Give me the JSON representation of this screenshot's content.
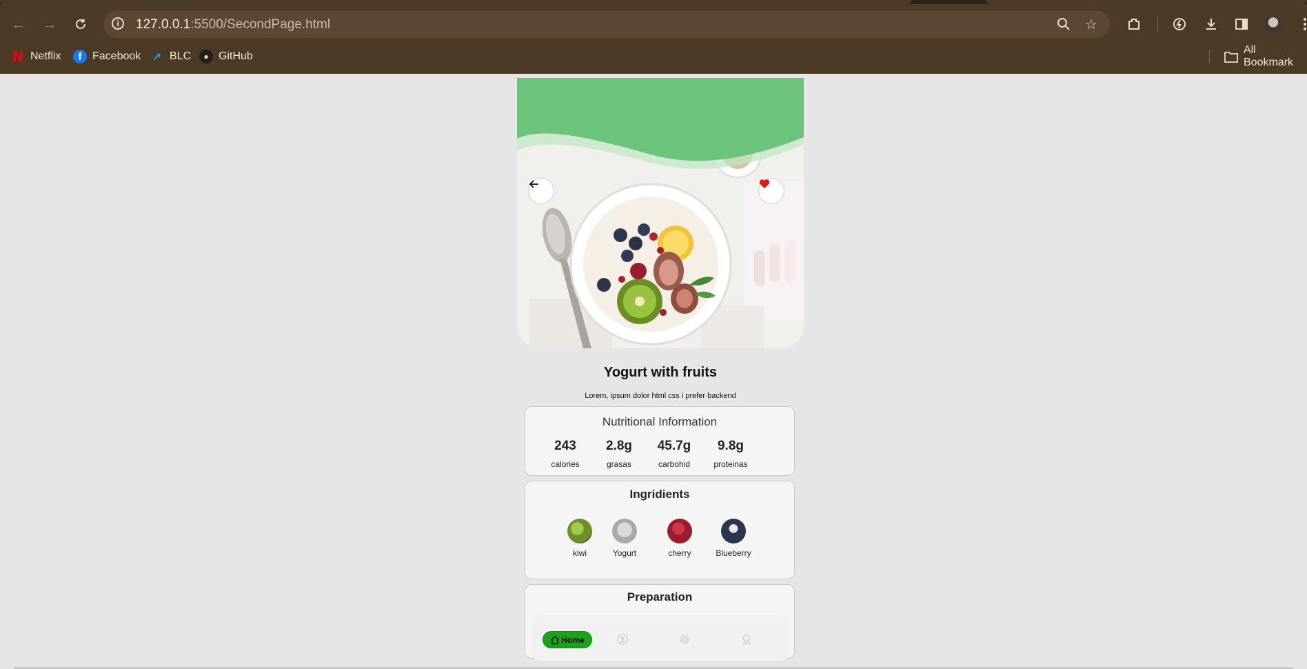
{
  "browser": {
    "url_host": "127.0.0.1",
    "url_path": ":5500/SecondPage.html",
    "bookmarks": [
      {
        "label": "Netflix",
        "icon": "netflix-icon"
      },
      {
        "label": "Facebook",
        "icon": "facebook-icon"
      },
      {
        "label": "BLC",
        "icon": "blc-icon"
      },
      {
        "label": "GitHub",
        "icon": "github-icon"
      }
    ],
    "all_bookmarks": "All Bookmark"
  },
  "page": {
    "title": "Yogurt with fruits",
    "subtitle": "Lorem, ipsum dolor html css i prefer backend",
    "nutrition": {
      "heading": "Nutritional Information",
      "stats": [
        {
          "value": "243",
          "label": "calories"
        },
        {
          "value": "2.8g",
          "label": "grasas"
        },
        {
          "value": "45.7g",
          "label": "carbohid"
        },
        {
          "value": "9.8g",
          "label": "proteinas"
        }
      ]
    },
    "ingredients": {
      "heading": "Ingridients",
      "items": [
        {
          "label": "kiwi",
          "color": "#6e8f2a"
        },
        {
          "label": "Yogurt",
          "color": "#a9a9a9"
        },
        {
          "label": "cherry",
          "color": "#9b1c2c"
        },
        {
          "label": "Blueberry",
          "color": "#2b3550"
        }
      ]
    },
    "preparation": {
      "heading": "Preparation"
    },
    "tabbar": {
      "home_label": "Home"
    },
    "colors": {
      "hero_green": "#6cc47a",
      "accent_green": "#1aa31a",
      "heart_red": "#e01616"
    }
  }
}
